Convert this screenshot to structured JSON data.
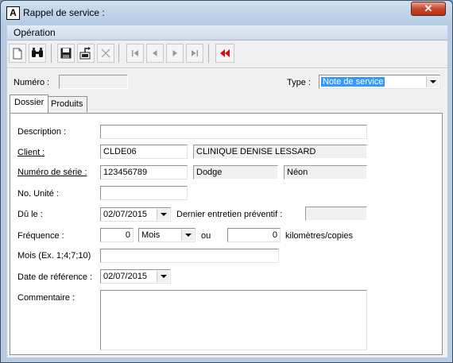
{
  "window": {
    "title": "Rappel de service :",
    "app_icon_glyph": "A",
    "close_glyph": "✕"
  },
  "menu": {
    "items": [
      "Opération"
    ]
  },
  "toolbar": {
    "buttons": [
      {
        "name": "new-document-icon",
        "glyph": "🗋"
      },
      {
        "name": "binoculars-icon",
        "glyph": "🔍"
      },
      {
        "name": "save-icon",
        "glyph": "💾"
      },
      {
        "name": "export-icon",
        "glyph": "⎘"
      },
      {
        "name": "delete-icon",
        "glyph": "✕"
      },
      {
        "name": "first-record-icon",
        "glyph": "⏮"
      },
      {
        "name": "previous-record-icon",
        "glyph": "◀"
      },
      {
        "name": "next-record-icon",
        "glyph": "▶"
      },
      {
        "name": "last-record-icon",
        "glyph": "⏭"
      },
      {
        "name": "rewind-red-icon",
        "glyph": "◀◀"
      }
    ],
    "accent_red": "#d01010"
  },
  "header": {
    "numero_label": "Numéro :",
    "numero_value": "",
    "type_label": "Type :",
    "type_value": "Note de service"
  },
  "tabs": [
    {
      "label": "Dossier",
      "active": true
    },
    {
      "label": "Produits",
      "active": false
    }
  ],
  "form": {
    "description_label": "Description :",
    "description_value": "",
    "client_label": "Client :",
    "client_code": "CLDE06",
    "client_name": "CLINIQUE DENISE LESSARD",
    "serie_label": "Numéro de série :",
    "serie_value": "123456789",
    "serie_make": "Dodge",
    "serie_model": "Néon",
    "unite_label": "No. Unité :",
    "unite_value": "",
    "due_label": "Dû le :",
    "due_value": "02/07/2015",
    "dernier_label": "Dernier entretien préventif :",
    "dernier_value": "",
    "frequence_label": "Fréquence :",
    "frequence_value": "0",
    "frequence_unit": "Mois",
    "ou_label": "ou",
    "km_value": "0",
    "km_label": "kilomètres/copies",
    "mois_label": "Mois (Ex. 1;4;7;10)",
    "mois_value": "",
    "reference_label": "Date de référence :",
    "reference_value": "02/07/2015",
    "commentaire_label": "Commentaire :",
    "commentaire_value": ""
  }
}
